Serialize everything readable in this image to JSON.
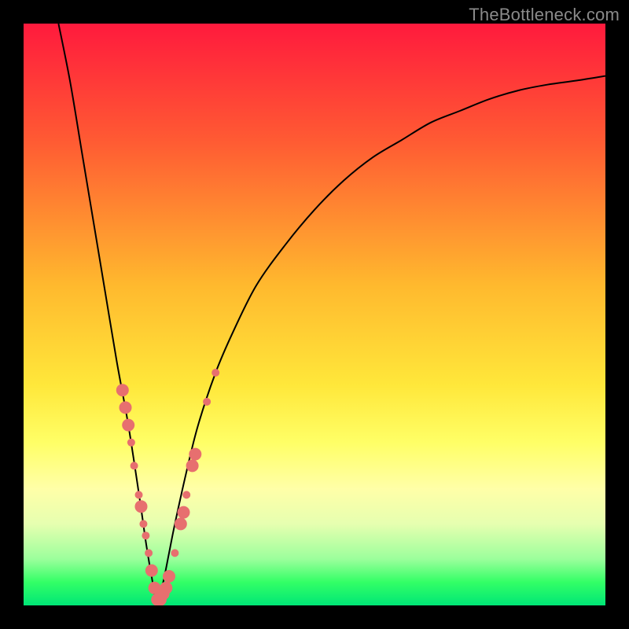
{
  "watermark": "TheBottleneck.com",
  "chart_data": {
    "type": "line",
    "title": "",
    "xlabel": "",
    "ylabel": "",
    "xlim": [
      0,
      100
    ],
    "ylim": [
      0,
      100
    ],
    "gradient_stops": [
      {
        "offset": 0.0,
        "color": "#ff1a3d"
      },
      {
        "offset": 0.2,
        "color": "#ff5a33"
      },
      {
        "offset": 0.45,
        "color": "#ffb92e"
      },
      {
        "offset": 0.62,
        "color": "#ffe73a"
      },
      {
        "offset": 0.72,
        "color": "#ffff66"
      },
      {
        "offset": 0.8,
        "color": "#ffffa8"
      },
      {
        "offset": 0.86,
        "color": "#e6ffb0"
      },
      {
        "offset": 0.92,
        "color": "#9cff9c"
      },
      {
        "offset": 0.96,
        "color": "#33ff66"
      },
      {
        "offset": 1.0,
        "color": "#00e676"
      }
    ],
    "optimum_x": 23,
    "series": [
      {
        "name": "bottleneck-curve",
        "comment": "V-shaped curve; y ~ 0 at optimum_x=23, rising steeply on both sides. Values estimated from pixels (no axis ticks shown).",
        "x": [
          6,
          8,
          10,
          12,
          14,
          16,
          18,
          20,
          21,
          22,
          23,
          24,
          25,
          26,
          28,
          30,
          33,
          36,
          40,
          45,
          50,
          55,
          60,
          65,
          70,
          75,
          80,
          85,
          90,
          95,
          100
        ],
        "y": [
          100,
          90,
          78,
          66,
          54,
          42,
          31,
          18,
          11,
          5,
          0,
          4,
          9,
          14,
          23,
          31,
          40,
          47,
          55,
          62,
          68,
          73,
          77,
          80,
          83,
          85,
          87,
          88.5,
          89.5,
          90.2,
          91
        ]
      }
    ],
    "points": {
      "name": "sample-markers",
      "color": "#e76f6f",
      "radius_small": 5,
      "radius_large": 8,
      "items": [
        {
          "x": 17.0,
          "y": 37,
          "r": "large"
        },
        {
          "x": 17.5,
          "y": 34,
          "r": "large"
        },
        {
          "x": 18.0,
          "y": 31,
          "r": "large"
        },
        {
          "x": 18.5,
          "y": 28,
          "r": "small"
        },
        {
          "x": 19.0,
          "y": 24,
          "r": "small"
        },
        {
          "x": 19.8,
          "y": 19,
          "r": "small"
        },
        {
          "x": 20.2,
          "y": 17,
          "r": "large"
        },
        {
          "x": 20.6,
          "y": 14,
          "r": "small"
        },
        {
          "x": 21.0,
          "y": 12,
          "r": "small"
        },
        {
          "x": 21.5,
          "y": 9,
          "r": "small"
        },
        {
          "x": 22.0,
          "y": 6,
          "r": "large"
        },
        {
          "x": 22.5,
          "y": 3,
          "r": "large"
        },
        {
          "x": 23.0,
          "y": 1,
          "r": "large"
        },
        {
          "x": 23.5,
          "y": 1,
          "r": "large"
        },
        {
          "x": 24.0,
          "y": 2,
          "r": "large"
        },
        {
          "x": 24.5,
          "y": 3,
          "r": "large"
        },
        {
          "x": 25.0,
          "y": 5,
          "r": "large"
        },
        {
          "x": 26.0,
          "y": 9,
          "r": "small"
        },
        {
          "x": 27.0,
          "y": 14,
          "r": "large"
        },
        {
          "x": 27.5,
          "y": 16,
          "r": "large"
        },
        {
          "x": 28.0,
          "y": 19,
          "r": "small"
        },
        {
          "x": 29.0,
          "y": 24,
          "r": "large"
        },
        {
          "x": 29.5,
          "y": 26,
          "r": "large"
        },
        {
          "x": 31.5,
          "y": 35,
          "r": "small"
        },
        {
          "x": 33.0,
          "y": 40,
          "r": "small"
        }
      ]
    }
  }
}
